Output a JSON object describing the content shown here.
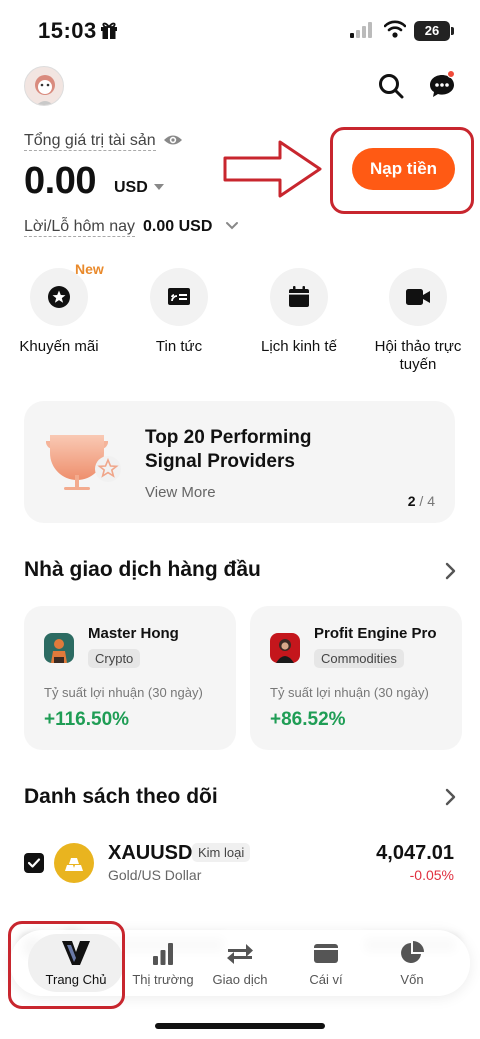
{
  "status_bar": {
    "time": "15:03",
    "battery": "26"
  },
  "balance": {
    "label": "Tổng giá trị tài sản",
    "amount": "0.00",
    "currency": "USD",
    "pnl_label": "Lời/Lỗ hôm nay",
    "pnl_value": "0.00 USD"
  },
  "deposit_button": "Nạp tiền",
  "quick_actions": {
    "new_badge": "New",
    "items": [
      {
        "label": "Khuyến mãi",
        "icon": "star-badge-icon"
      },
      {
        "label": "Tin tức",
        "icon": "news-icon"
      },
      {
        "label": "Lịch kinh tế",
        "icon": "calendar-icon"
      },
      {
        "label": "Hội thảo trực tuyến",
        "icon": "video-icon"
      }
    ]
  },
  "promo": {
    "title": "Top 20 Performing Signal Providers",
    "link": "View More",
    "page_current": "2",
    "page_sep": " / ",
    "page_total": "4"
  },
  "top_traders": {
    "title": "Nhà giao dịch hàng đầu",
    "metric_label": "Tỷ suất lợi nhuận (30 ngày)",
    "items": [
      {
        "name": "Master Hong",
        "tag": "Crypto",
        "return": "+116.50%"
      },
      {
        "name": "Profit Engine Pro",
        "tag": "Commodities",
        "return": "+86.52%"
      }
    ]
  },
  "watchlist": {
    "title": "Danh sách theo dõi",
    "items": [
      {
        "symbol": "XAUUSD",
        "badge": "Kim loại",
        "description": "Gold/US Dollar",
        "price": "4,047.01",
        "change": "-0.05%"
      }
    ]
  },
  "bottom_nav": {
    "items": [
      {
        "label": "Trang Chủ",
        "icon": "home-logo-icon"
      },
      {
        "label": "Thị trường",
        "icon": "bar-chart-icon"
      },
      {
        "label": "Giao dịch",
        "icon": "swap-arrows-icon"
      },
      {
        "label": "Cái ví",
        "icon": "wallet-icon"
      },
      {
        "label": "Vốn",
        "icon": "pie-chart-icon"
      }
    ]
  },
  "colors": {
    "accent": "#ff5a14",
    "positive": "#1f9d55",
    "negative": "#e0303f",
    "annotation": "#c8262e"
  }
}
